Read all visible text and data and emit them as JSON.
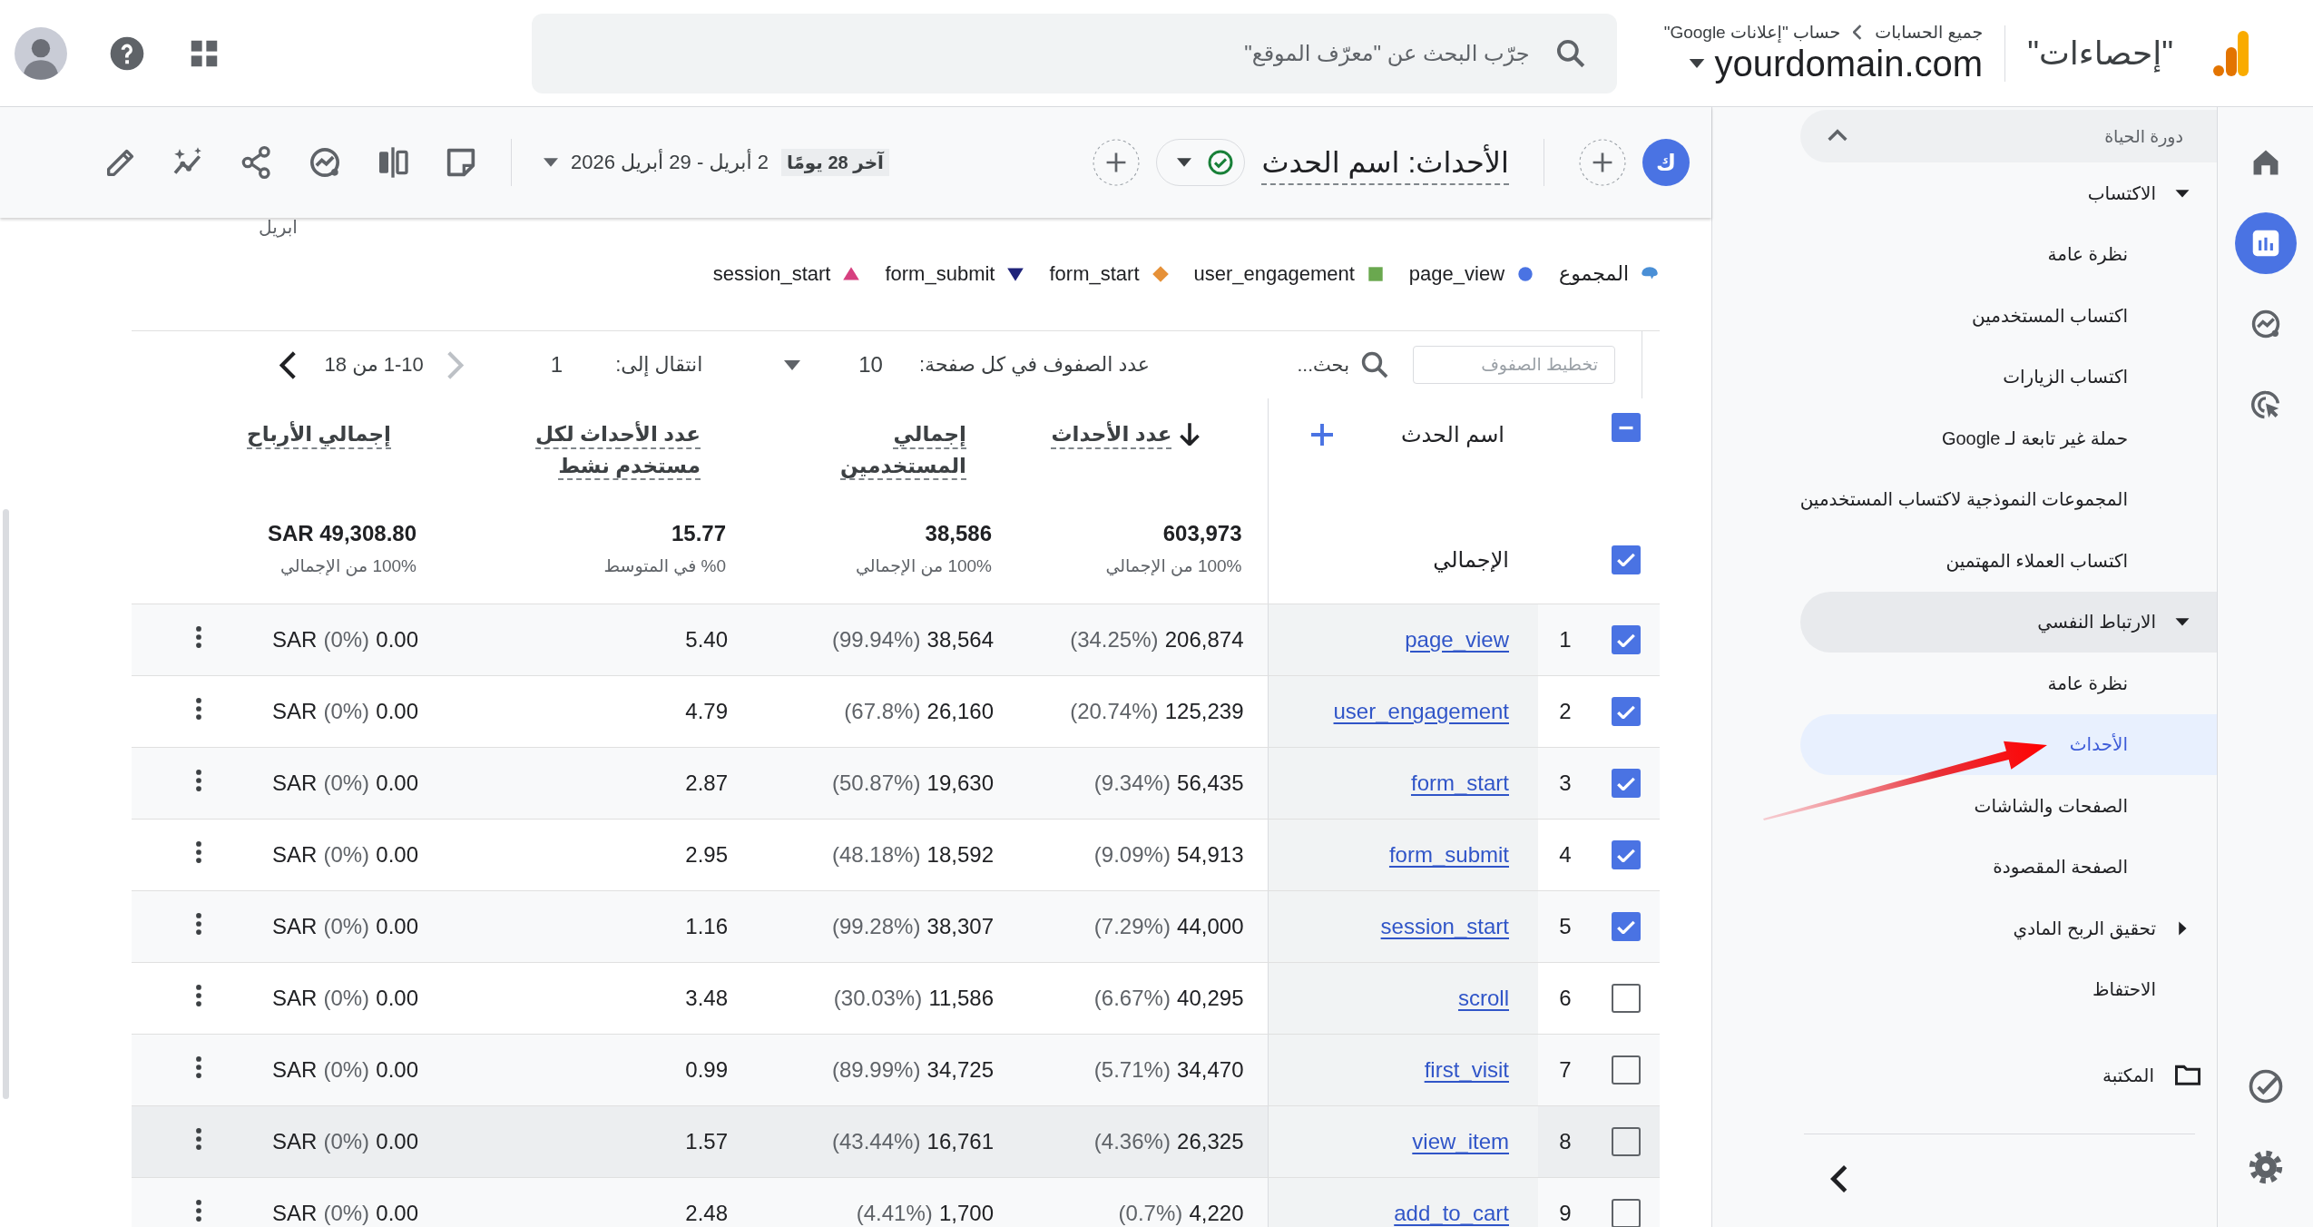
{
  "app": {
    "title": "\"إحصاءات\"",
    "breadcrumb": [
      "جميع الحسابات",
      "حساب \"إعلانات Google\""
    ],
    "property": "yourdomain.com"
  },
  "search": {
    "placeholder": "جرّب البحث عن \"معرّف الموقع\""
  },
  "rail": [
    {
      "kind": "home",
      "selected": false
    },
    {
      "kind": "reports",
      "selected": true
    },
    {
      "kind": "explore",
      "selected": false
    },
    {
      "kind": "advertising",
      "selected": false
    }
  ],
  "nav": {
    "header": "دورة الحياة",
    "expanded": true,
    "library": "المكتبة",
    "sections": [
      {
        "kind": "group",
        "label": "الاكتساب",
        "expanded": true,
        "active": false,
        "children": [
          {
            "label": "نظرة عامة",
            "selected": false
          },
          {
            "label": "اكتساب المستخدمين",
            "selected": false
          },
          {
            "label": "اكتساب الزيارات",
            "selected": false
          },
          {
            "label": "حملة غير تابعة لـ Google",
            "selected": false
          },
          {
            "label": "المجموعات النموذجية لاكتساب المستخدمين",
            "selected": false
          },
          {
            "label": "اكتساب العملاء المهتمين",
            "selected": false
          }
        ]
      },
      {
        "kind": "group",
        "label": "الارتباط النفسي",
        "expanded": true,
        "active": true,
        "children": [
          {
            "label": "نظرة عامة",
            "selected": false
          },
          {
            "label": "الأحداث",
            "selected": true
          },
          {
            "label": "الصفحات والشاشات",
            "selected": false
          },
          {
            "label": "الصفحة المقصودة",
            "selected": false
          }
        ]
      },
      {
        "kind": "group",
        "label": "تحقيق الربح المادي",
        "expanded": false,
        "active": false
      },
      {
        "kind": "link",
        "label": "الاحتفاظ",
        "active": false
      }
    ]
  },
  "report": {
    "badge": "ك",
    "title": "الأحداث: اسم الحدث",
    "date_preset": "آخر 28 يومًا",
    "date_range": "2 أبريل - 29 أبريل 2026"
  },
  "chart_axis_label": "ابريل",
  "legend": [
    {
      "label": "المجموع",
      "kind": "total",
      "color": "#4a8fd6"
    },
    {
      "label": "page_view",
      "kind": "circle",
      "color": "#4a73e3"
    },
    {
      "label": "user_engagement",
      "kind": "square",
      "color": "#6aa84f"
    },
    {
      "label": "form_start",
      "kind": "diamond",
      "color": "#e69138"
    },
    {
      "label": "form_submit",
      "kind": "triangle-down",
      "color": "#1f237a"
    },
    {
      "label": "session_start",
      "kind": "triangle-up",
      "color": "#d6407f"
    }
  ],
  "table": {
    "row_filter_placeholder": "تخطيط الصفوف",
    "search_placeholder": "بحث...",
    "rows_per_page_label": "عدد الصفوف في كل صفحة:",
    "rows_per_page": "10",
    "goto_label": "انتقال إلى:",
    "goto_page": "1",
    "range": "1-10 من 18",
    "prev_enabled": false,
    "next_enabled": true,
    "select_all": {
      "checked": true,
      "mixed": true
    },
    "name_column": {
      "label": "اسم الحدث"
    },
    "columns": [
      {
        "label": "عدد الأحداث",
        "sorted": true
      },
      {
        "label": "إجمالي المستخدمين",
        "sorted": false
      },
      {
        "label": "عدد الأحداث لكل مستخدم نشط",
        "sorted": false
      },
      {
        "label": "إجمالي الأرباح",
        "sorted": false
      }
    ],
    "totals": {
      "label": "الإجمالي",
      "checked": true,
      "cells": [
        {
          "value": "603,973",
          "note": "100% من الإجمالي"
        },
        {
          "value": "38,586",
          "note": "100% من الإجمالي"
        },
        {
          "value": "15.77",
          "note": "%0 في المتوسط"
        },
        {
          "value": "SAR 49,308.80",
          "note": "100% من الإجمالي"
        }
      ]
    },
    "rows": [
      {
        "index": "1",
        "name": "page_view",
        "checked": true,
        "highlighted": false,
        "cells": [
          {
            "pct": "(34.25%)",
            "value": "206,874"
          },
          {
            "pct": "(99.94%)",
            "value": "38,564"
          },
          {
            "value": "5.40"
          },
          {
            "prefix": "SAR",
            "pct": "(0%)",
            "value": "0.00"
          }
        ]
      },
      {
        "index": "2",
        "name": "user_engagement",
        "checked": true,
        "highlighted": false,
        "cells": [
          {
            "pct": "(20.74%)",
            "value": "125,239"
          },
          {
            "pct": "(67.8%)",
            "value": "26,160"
          },
          {
            "value": "4.79"
          },
          {
            "prefix": "SAR",
            "pct": "(0%)",
            "value": "0.00"
          }
        ]
      },
      {
        "index": "3",
        "name": "form_start",
        "checked": true,
        "highlighted": false,
        "cells": [
          {
            "pct": "(9.34%)",
            "value": "56,435"
          },
          {
            "pct": "(50.87%)",
            "value": "19,630"
          },
          {
            "value": "2.87"
          },
          {
            "prefix": "SAR",
            "pct": "(0%)",
            "value": "0.00"
          }
        ]
      },
      {
        "index": "4",
        "name": "form_submit",
        "checked": true,
        "highlighted": false,
        "cells": [
          {
            "pct": "(9.09%)",
            "value": "54,913"
          },
          {
            "pct": "(48.18%)",
            "value": "18,592"
          },
          {
            "value": "2.95"
          },
          {
            "prefix": "SAR",
            "pct": "(0%)",
            "value": "0.00"
          }
        ]
      },
      {
        "index": "5",
        "name": "session_start",
        "checked": true,
        "highlighted": false,
        "cells": [
          {
            "pct": "(7.29%)",
            "value": "44,000"
          },
          {
            "pct": "(99.28%)",
            "value": "38,307"
          },
          {
            "value": "1.16"
          },
          {
            "prefix": "SAR",
            "pct": "(0%)",
            "value": "0.00"
          }
        ]
      },
      {
        "index": "6",
        "name": "scroll",
        "checked": false,
        "highlighted": false,
        "cells": [
          {
            "pct": "(6.67%)",
            "value": "40,295"
          },
          {
            "pct": "(30.03%)",
            "value": "11,586"
          },
          {
            "value": "3.48"
          },
          {
            "prefix": "SAR",
            "pct": "(0%)",
            "value": "0.00"
          }
        ]
      },
      {
        "index": "7",
        "name": "first_visit",
        "checked": false,
        "highlighted": false,
        "cells": [
          {
            "pct": "(5.71%)",
            "value": "34,470"
          },
          {
            "pct": "(89.99%)",
            "value": "34,725"
          },
          {
            "value": "0.99"
          },
          {
            "prefix": "SAR",
            "pct": "(0%)",
            "value": "0.00"
          }
        ]
      },
      {
        "index": "8",
        "name": "view_item",
        "checked": false,
        "highlighted": true,
        "cells": [
          {
            "pct": "(4.36%)",
            "value": "26,325"
          },
          {
            "pct": "(43.44%)",
            "value": "16,761"
          },
          {
            "value": "1.57"
          },
          {
            "prefix": "SAR",
            "pct": "(0%)",
            "value": "0.00"
          }
        ]
      },
      {
        "index": "9",
        "name": "add_to_cart",
        "checked": false,
        "highlighted": false,
        "cells": [
          {
            "pct": "(0.7%)",
            "value": "4,220"
          },
          {
            "pct": "(4.41%)",
            "value": "1,700"
          },
          {
            "value": "2.48"
          },
          {
            "prefix": "SAR",
            "pct": "(0%)",
            "value": "0.00"
          }
        ]
      }
    ]
  }
}
